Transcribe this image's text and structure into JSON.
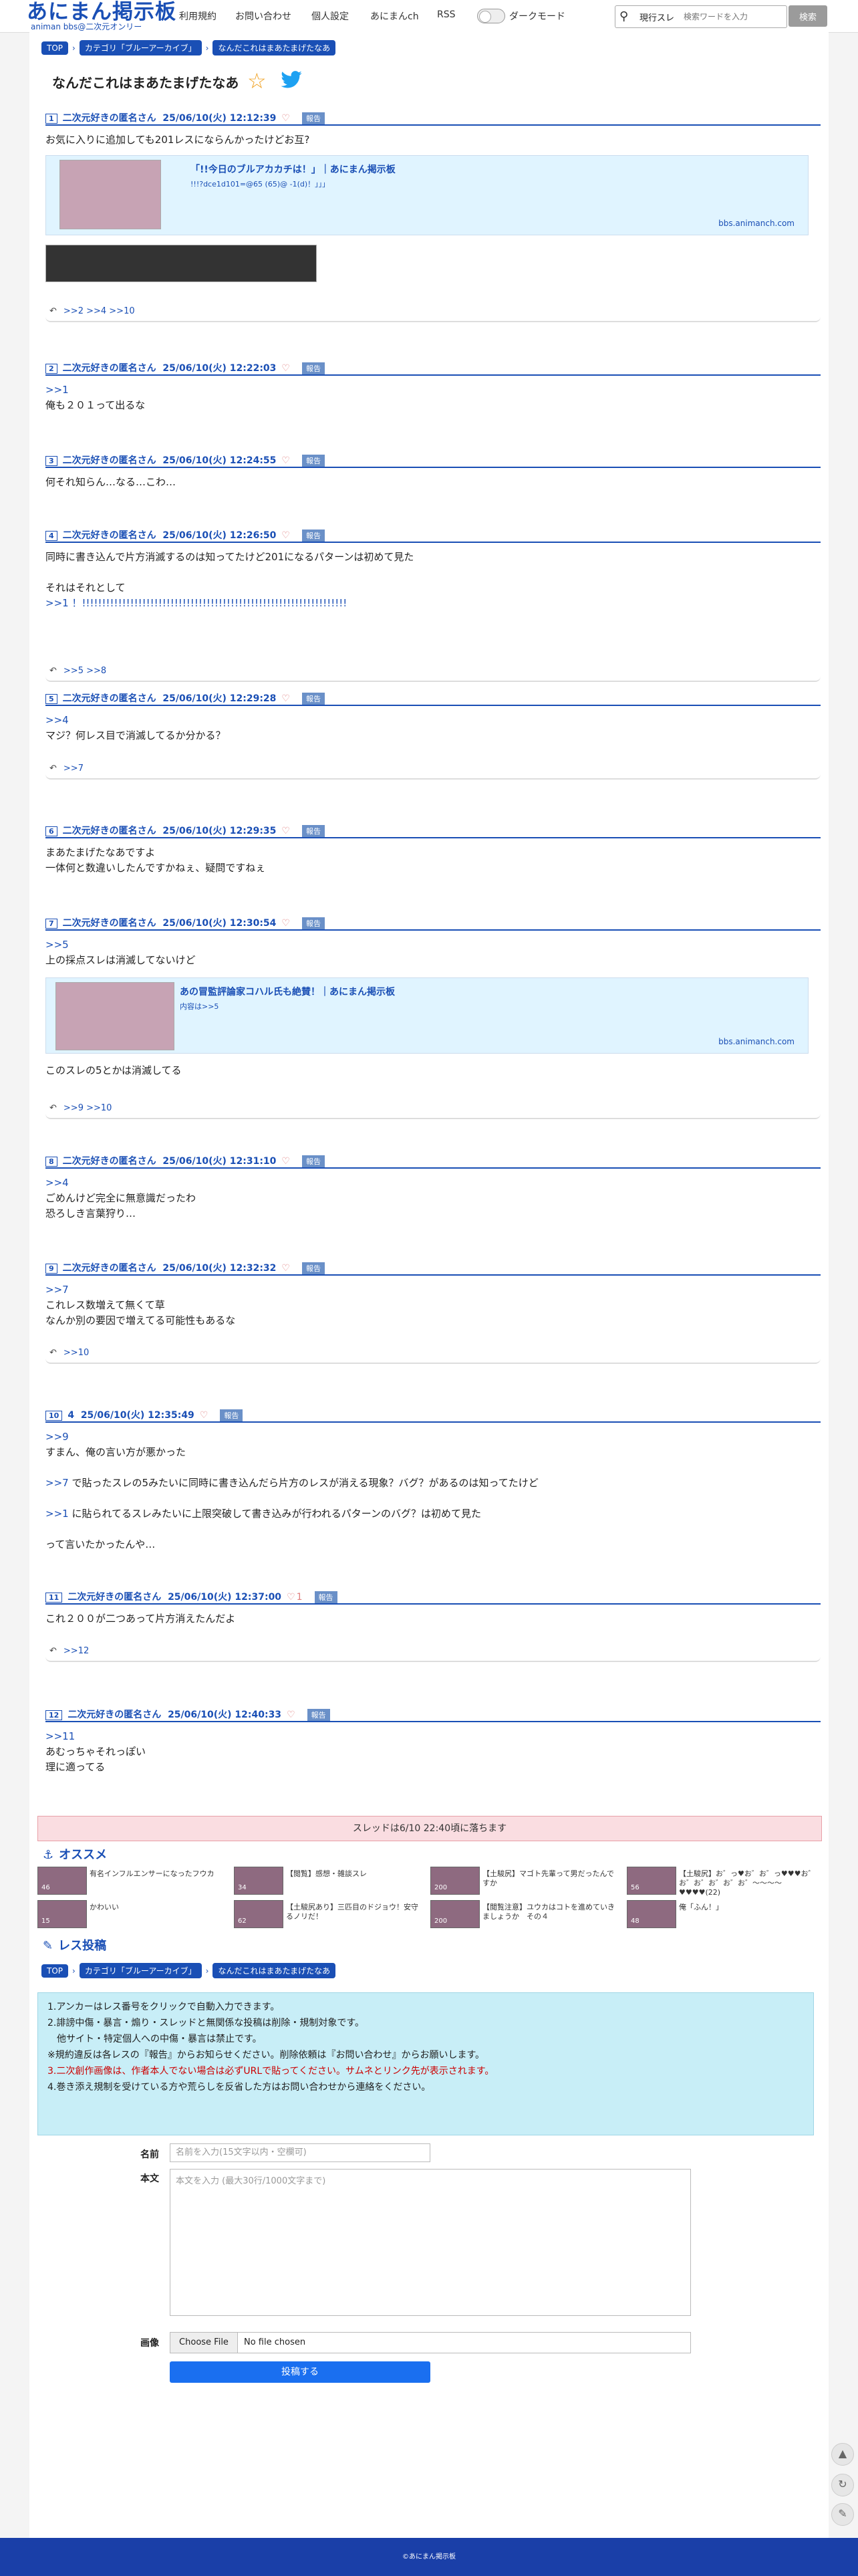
{
  "header": {
    "logo_title": "あにまん掲示板",
    "logo_subtitle": "animan bbs@二次元オンリー",
    "nav": [
      "利用規約",
      "お問い合わせ",
      "個人設定",
      "あにまんch",
      "RSS"
    ],
    "dark_mode_label": "ダークモード",
    "search_scope": "現行スレ",
    "search_placeholder": "検索ワードを入力",
    "search_button": "検索"
  },
  "breadcrumb": [
    "TOP",
    "カテゴリ「ブルーアーカイブ」",
    "なんだこれはまあたまげたなあ"
  ],
  "thread": {
    "title": "なんだこれはまあたまげたなあ"
  },
  "posts": [
    {
      "num": "1",
      "name": "二次元好きの匿名さん",
      "date": "25/06/10(火) 12:12:39",
      "report": "報告",
      "lines": [
        "お気に入りに追加しても201レスにならんかったけどお互?"
      ],
      "ogp": {
        "title": "「!!今日のブルアカカチは！」｜あにまん掲示板",
        "sub": "!!!?dce1d101=@65 (65)@ -1(d)！」」」",
        "domain": "bbs.animanch.com"
      },
      "replies": ">>2 >>4 >>10"
    },
    {
      "num": "2",
      "name": "二次元好きの匿名さん",
      "date": "25/06/10(火) 12:22:03",
      "report": "報告",
      "anchor": ">>1",
      "lines": [
        "俺も２０１って出るな"
      ]
    },
    {
      "num": "3",
      "name": "二次元好きの匿名さん",
      "date": "25/06/10(火) 12:24:55",
      "report": "報告",
      "lines": [
        "何それ知らん…なる…こわ…"
      ]
    },
    {
      "num": "4",
      "name": "二次元好きの匿名さん",
      "date": "25/06/10(火) 12:26:50",
      "report": "報告",
      "lines": [
        "同時に書き込んで片方消滅するのは知ってたけど201になるパターンは初めて見た",
        "",
        "それはそれとして"
      ],
      "anchor_line": ">>1 ！!!!!!!!!!!!!!!!!!!!!!!!!!!!!!!!!!!!!!!!!!!!!!!!!!!!!!!!!!!!!!!!!!!",
      "replies": ">>5 >>8"
    },
    {
      "num": "5",
      "name": "二次元好きの匿名さん",
      "date": "25/06/10(火) 12:29:28",
      "report": "報告",
      "anchor": ">>4",
      "lines": [
        "マジ？何レス目で消滅してるか分かる？"
      ],
      "replies": ">>7"
    },
    {
      "num": "6",
      "name": "二次元好きの匿名さん",
      "date": "25/06/10(火) 12:29:35",
      "report": "報告",
      "lines": [
        "まあたまげたなあですよ",
        "一体何と数違いしたんですかねぇ、疑問ですねぇ"
      ]
    },
    {
      "num": "7",
      "name": "二次元好きの匿名さん",
      "date": "25/06/10(火) 12:30:54",
      "report": "報告",
      "anchor": ">>5",
      "lines": [
        "上の採点スレは消滅してないけど"
      ],
      "ogp": {
        "title": "あの冒監評論家コハル氏も絶賛！｜あにまん掲示板",
        "sub": "内容は>>5",
        "domain": "bbs.animanch.com"
      },
      "after": "このスレの5とかは消滅してる",
      "replies": ">>9 >>10"
    },
    {
      "num": "8",
      "name": "二次元好きの匿名さん",
      "date": "25/06/10(火) 12:31:10",
      "report": "報告",
      "anchor": ">>4",
      "lines": [
        "ごめんけど完全に無意識だったわ",
        "恐ろしき言葉狩り…"
      ]
    },
    {
      "num": "9",
      "name": "二次元好きの匿名さん",
      "date": "25/06/10(火) 12:32:32",
      "report": "報告",
      "anchor": ">>7",
      "lines": [
        "これレス数増えて無くて草",
        "なんか別の要因で増えてる可能性もあるな"
      ],
      "replies": ">>10"
    },
    {
      "num": "10",
      "name": "4",
      "date": "25/06/10(火) 12:35:49",
      "report": "報告",
      "anchor": ">>9",
      "lines": [
        "すまん、俺の言い方が悪かった"
      ],
      "l2a": ">>7",
      "l2": " で貼ったスレの5みたいに同時に書き込んだら片方のレスが消える現象？バグ？があるのは知ってたけど",
      "l3a": ">>1",
      "l3": " に貼られてるスレみたいに上限突破して書き込みが行われるパターンのバグ？は初めて見た",
      "l4": "って言いたかったんや…"
    },
    {
      "num": "11",
      "name": "二次元好きの匿名さん",
      "date": "25/06/10(火) 12:37:00",
      "report": "報告",
      "likes": "1",
      "lines": [
        "これ２００が二つあって片方消えたんだよ"
      ],
      "replies": ">>12"
    },
    {
      "num": "12",
      "name": "二次元好きの匿名さん",
      "date": "25/06/10(火) 12:40:33",
      "report": "報告",
      "anchor": ">>11",
      "lines": [
        "あむっちゃそれっぽい",
        "理に適ってる"
      ]
    }
  ],
  "drop_notice": "スレッドは6/10 22:40頃に落ちます",
  "recommend": {
    "title": "オススメ",
    "items": [
      {
        "text": "有名インフルエンサーになったフウカ",
        "count": "46"
      },
      {
        "text": "【閲覧】感想・雑談スレ",
        "count": "34"
      },
      {
        "text": "【土駿尻】マゴト先輩って男だったんですか",
        "count": "200"
      },
      {
        "text": "【土駿尻】お゛っ♥お゛お゛っ♥♥♥お゛お゛お゛お゛お゛お゛〜〜〜〜♥♥♥♥(22)",
        "count": "56"
      },
      {
        "text": "かわいい",
        "count": "15"
      },
      {
        "text": "【土駿尻あり】三匹目のドジョウ！安守るノリだ！",
        "count": "62"
      },
      {
        "text": "【閲覧注意】ユウカはコトを進めていきましょうか　その４",
        "count": "200"
      },
      {
        "text": "俺「ふん！」",
        "count": "48"
      }
    ]
  },
  "form": {
    "title": "レス投稿",
    "rules": [
      "1.アンカーはレス番号をクリックで自動入力できます。",
      "2.誹謗中傷・暴言・煽り・スレッドと無関係な投稿は削除・規制対象です。",
      "　他サイト・特定個人への中傷・暴言は禁止です。",
      "※規約違反は各レスの『報告』からお知らせください。削除依頼は『お問い合わせ』からお願いします。",
      "3.二次創作画像は、作者本人でない場合は必ずURLで貼ってください。サムネとリンク先が表示されます。",
      "4.巻き添え規制を受けている方や荒らしを反省した方はお問い合わせから連絡をください。"
    ],
    "name_label": "名前",
    "name_placeholder": "名前を入力(15文字以内・空欄可)",
    "body_label": "本文",
    "body_placeholder": "本文を入力 (最大30行/1000文字まで)",
    "image_label": "画像",
    "file_button": "Choose File",
    "file_status": "No file chosen",
    "submit": "投稿する"
  },
  "footer": "©あにまん掲示板"
}
